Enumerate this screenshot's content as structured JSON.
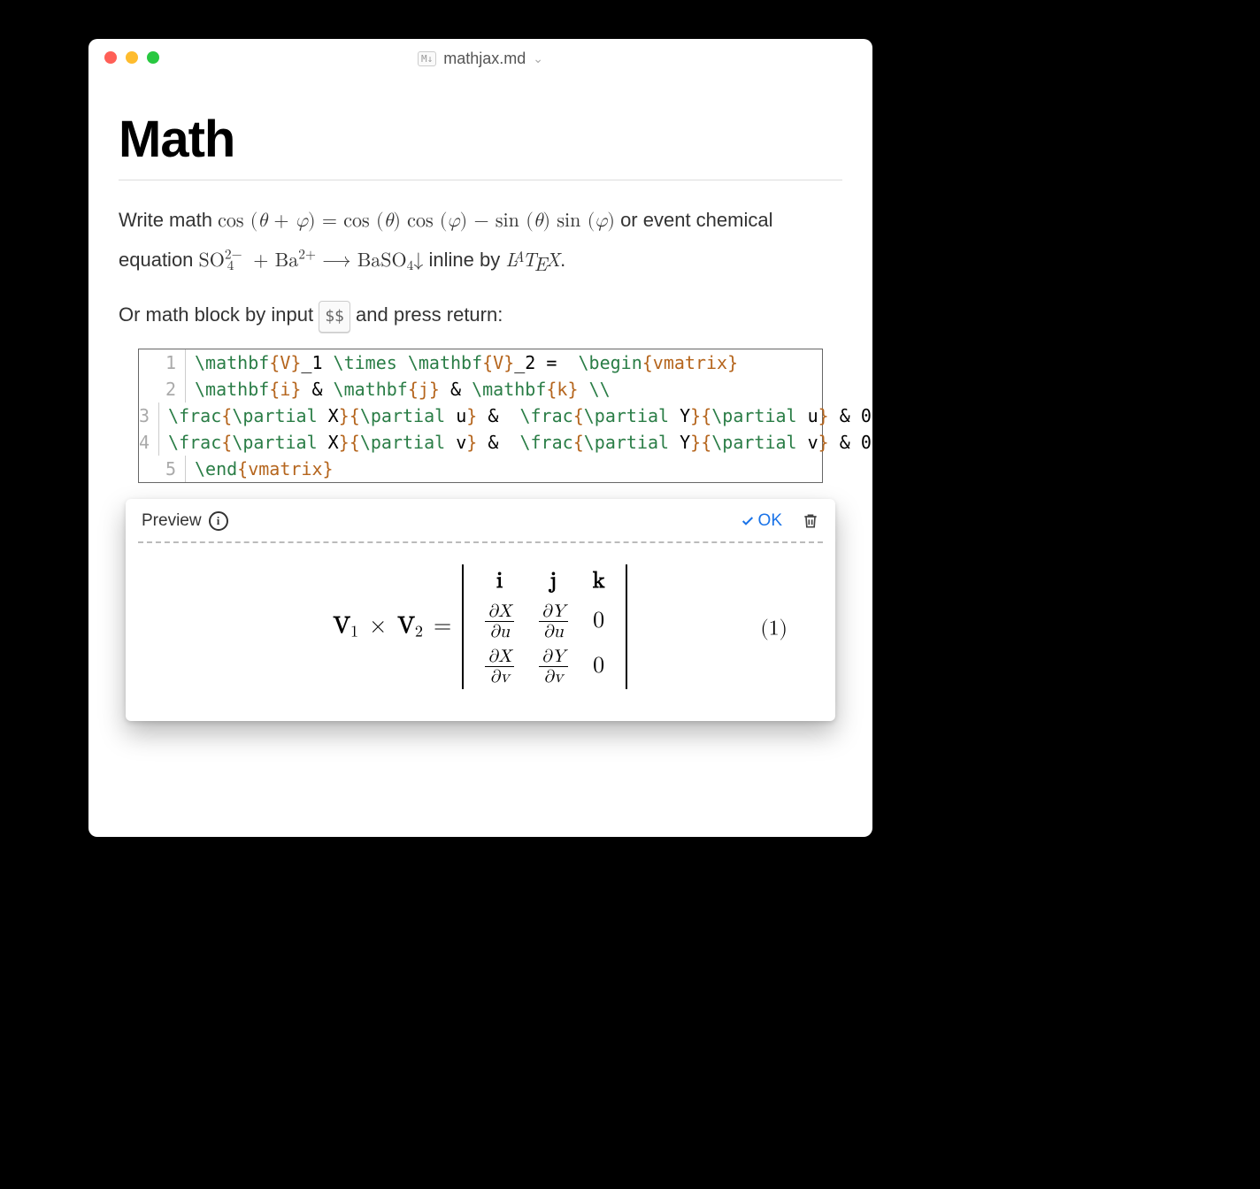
{
  "window": {
    "filename": "mathjax.md"
  },
  "doc": {
    "heading": "Math",
    "para1_pre": "Write math ",
    "para1_math": "cos (θ + φ) = cos (θ) cos (φ) − sin (θ) sin (φ)",
    "para1_mid": "  or event chemical equation ",
    "para1_chem": "SO₄²⁻ + Ba²⁺ ⟶ BaSO₄↓",
    "para1_post": "  inline by ",
    "para1_end": ".",
    "para2_pre": "Or math block by input ",
    "para2_kbd": "$$",
    "para2_post": " and press return:"
  },
  "code": {
    "lines": [
      {
        "n": "1",
        "segs": [
          [
            "cmd",
            "\\mathbf"
          ],
          [
            "grp",
            "{V}"
          ],
          [
            "txt",
            "_1 "
          ],
          [
            "cmd",
            "\\times"
          ],
          [
            "txt",
            " "
          ],
          [
            "cmd",
            "\\mathbf"
          ],
          [
            "grp",
            "{V}"
          ],
          [
            "txt",
            "_2 =  "
          ],
          [
            "cmd",
            "\\begin"
          ],
          [
            "grp",
            "{vmatrix}"
          ]
        ]
      },
      {
        "n": "2",
        "segs": [
          [
            "cmd",
            "\\mathbf"
          ],
          [
            "grp",
            "{i}"
          ],
          [
            "txt",
            " & "
          ],
          [
            "cmd",
            "\\mathbf"
          ],
          [
            "grp",
            "{j}"
          ],
          [
            "txt",
            " & "
          ],
          [
            "cmd",
            "\\mathbf"
          ],
          [
            "grp",
            "{k}"
          ],
          [
            "txt",
            " "
          ],
          [
            "cmd",
            "\\\\"
          ]
        ]
      },
      {
        "n": "3",
        "segs": [
          [
            "cmd",
            "\\frac"
          ],
          [
            "grp",
            "{"
          ],
          [
            "cmd",
            "\\partial"
          ],
          [
            "txt",
            " X"
          ],
          [
            "grp",
            "}{"
          ],
          [
            "cmd",
            "\\partial"
          ],
          [
            "txt",
            " u"
          ],
          [
            "grp",
            "}"
          ],
          [
            "txt",
            " &  "
          ],
          [
            "cmd",
            "\\frac"
          ],
          [
            "grp",
            "{"
          ],
          [
            "cmd",
            "\\partial"
          ],
          [
            "txt",
            " Y"
          ],
          [
            "grp",
            "}{"
          ],
          [
            "cmd",
            "\\partial"
          ],
          [
            "txt",
            " u"
          ],
          [
            "grp",
            "}"
          ],
          [
            "txt",
            " & 0 "
          ],
          [
            "cmd",
            "\\\\"
          ]
        ]
      },
      {
        "n": "4",
        "segs": [
          [
            "cmd",
            "\\frac"
          ],
          [
            "grp",
            "{"
          ],
          [
            "cmd",
            "\\partial"
          ],
          [
            "txt",
            " X"
          ],
          [
            "grp",
            "}{"
          ],
          [
            "cmd",
            "\\partial"
          ],
          [
            "txt",
            " v"
          ],
          [
            "grp",
            "}"
          ],
          [
            "txt",
            " &  "
          ],
          [
            "cmd",
            "\\frac"
          ],
          [
            "grp",
            "{"
          ],
          [
            "cmd",
            "\\partial"
          ],
          [
            "txt",
            " Y"
          ],
          [
            "grp",
            "}{"
          ],
          [
            "cmd",
            "\\partial"
          ],
          [
            "txt",
            " v"
          ],
          [
            "grp",
            "}"
          ],
          [
            "txt",
            " & 0 "
          ],
          [
            "cmd",
            "\\\\"
          ]
        ]
      },
      {
        "n": "5",
        "segs": [
          [
            "cmd",
            "\\end"
          ],
          [
            "grp",
            "{vmatrix}"
          ]
        ]
      }
    ]
  },
  "preview": {
    "label": "Preview",
    "ok": "OK",
    "eq_number": "(1)",
    "lhs": {
      "V": "V",
      "sub1": "1",
      "times": "×",
      "sub2": "2",
      "eq": "="
    },
    "matrix": {
      "row1": [
        "i",
        "j",
        "k"
      ],
      "row2": [
        {
          "num": "∂X",
          "den": "∂u"
        },
        {
          "num": "∂Y",
          "den": "∂u"
        },
        "0"
      ],
      "row3": [
        {
          "num": "∂X",
          "den": "∂v"
        },
        {
          "num": "∂Y",
          "den": "∂v"
        },
        "0"
      ]
    }
  }
}
